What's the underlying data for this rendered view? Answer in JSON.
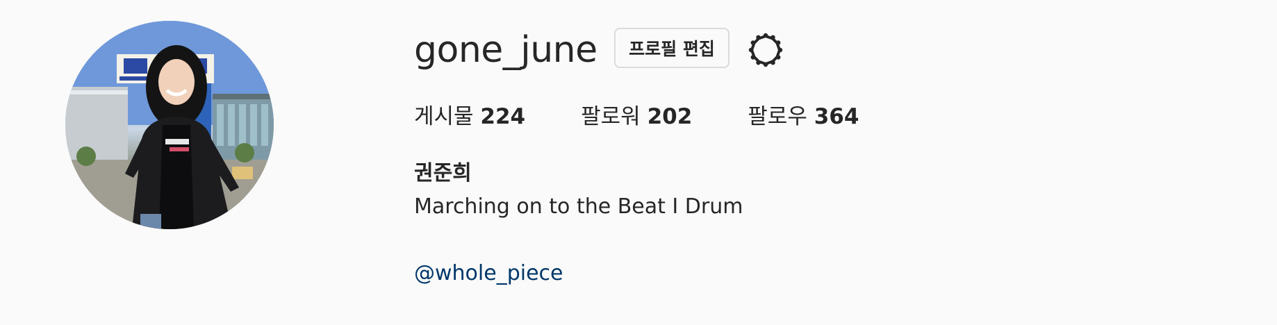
{
  "profile": {
    "username": "gone_june",
    "edit_button_label": "프로필 편집",
    "stats": [
      {
        "label": "게시물",
        "value": "224"
      },
      {
        "label": "팔로워",
        "value": "202"
      },
      {
        "label": "팔로우",
        "value": "364"
      }
    ],
    "full_name": "권준희",
    "bio": "Marching on to the Beat I Drum",
    "link": "@whole_piece"
  },
  "icons": {
    "settings": "gear-icon"
  },
  "colors": {
    "background": "#fafafa",
    "text": "#262626",
    "link": "#00376b",
    "button_border": "#dbdbdb"
  }
}
